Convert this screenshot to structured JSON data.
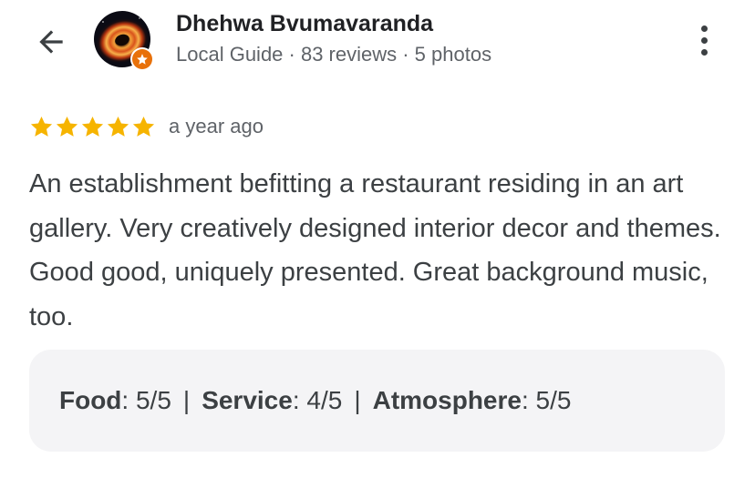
{
  "reviewer": {
    "name": "Dhehwa Bvumavaranda",
    "meta": "Local Guide · 83 reviews · 5 photos"
  },
  "review": {
    "rating": 5,
    "max_rating": 5,
    "date": "a year ago",
    "text": "An establishment befitting a restaurant residing in an art gallery. Very creatively designed interior decor and themes. Good good, uniquely presented. Great background music, too."
  },
  "attributes": [
    {
      "label": "Food",
      "colon": ":",
      "value": " 5/5"
    },
    {
      "label": "Service",
      "colon": ":",
      "value": " 4/5"
    },
    {
      "label": "Atmosphere",
      "colon": ":",
      "value": " 5/5"
    }
  ],
  "separator": "|",
  "icons": {
    "back": "arrow-back-icon",
    "more": "more-vert-icon",
    "star": "star-icon",
    "badge": "local-guide-badge-icon"
  },
  "colors": {
    "star": "#f6b400",
    "badge": "#e8710a",
    "secondary_text": "#5f6368",
    "attributes_bg": "#f4f4f6"
  }
}
